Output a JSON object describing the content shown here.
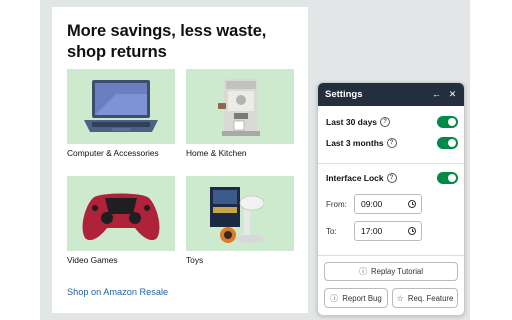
{
  "card": {
    "title": "More savings, less waste, shop returns",
    "tiles": [
      {
        "label": "Computer & Accessories"
      },
      {
        "label": "Home & Kitchen"
      },
      {
        "label": "Video Games"
      },
      {
        "label": "Toys"
      }
    ],
    "link": "Shop on Amazon Resale"
  },
  "settings": {
    "title": "Settings",
    "header_icons": [
      "back-arrow-icon",
      "close-icon"
    ],
    "toggles": [
      {
        "label": "Last 30 days",
        "on": true
      },
      {
        "label": "Last 3 months",
        "on": true
      },
      {
        "label": "Interface Lock",
        "on": true
      }
    ],
    "from_label": "From:",
    "from_value": "09:00",
    "to_label": "To:",
    "to_value": "17:00",
    "replay_label": "Replay Tutorial",
    "report_label": "Report Bug",
    "feature_label": "Req. Feature"
  },
  "colors": {
    "toggle_on": "#008a48",
    "header_bg": "#232f3e",
    "tile_bg": "#cdeacf",
    "link": "#2162a1"
  }
}
